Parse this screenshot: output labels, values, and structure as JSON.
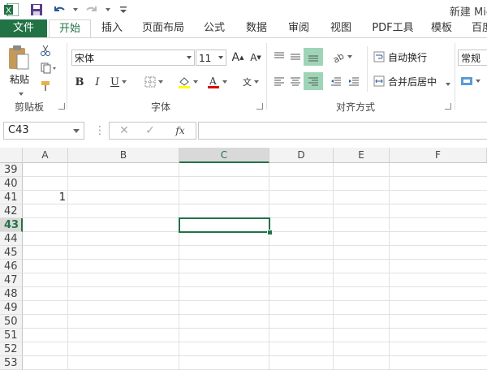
{
  "title": "新建 Mic",
  "tabs": [
    "文件",
    "开始",
    "插入",
    "页面布局",
    "公式",
    "数据",
    "审阅",
    "视图",
    "PDF工具",
    "模板",
    "百度"
  ],
  "clipboard": {
    "paste": "粘贴",
    "group": "剪贴板"
  },
  "font": {
    "name": "宋体",
    "size": "11",
    "group": "字体"
  },
  "alignment": {
    "wrap": "自动换行",
    "merge": "合并后居中",
    "group": "对齐方式"
  },
  "number": {
    "format": "常规"
  },
  "namebox": "C43",
  "columns": [
    "A",
    "B",
    "C",
    "D",
    "E",
    "F"
  ],
  "rows": [
    "39",
    "40",
    "41",
    "42",
    "43",
    "44",
    "45",
    "46",
    "47",
    "48",
    "49",
    "50",
    "51",
    "52",
    "53"
  ],
  "cell_A41": "1",
  "colors": {
    "accent": "#217346",
    "file_tab": "#217346",
    "selected_button": "#9fd5b7"
  }
}
